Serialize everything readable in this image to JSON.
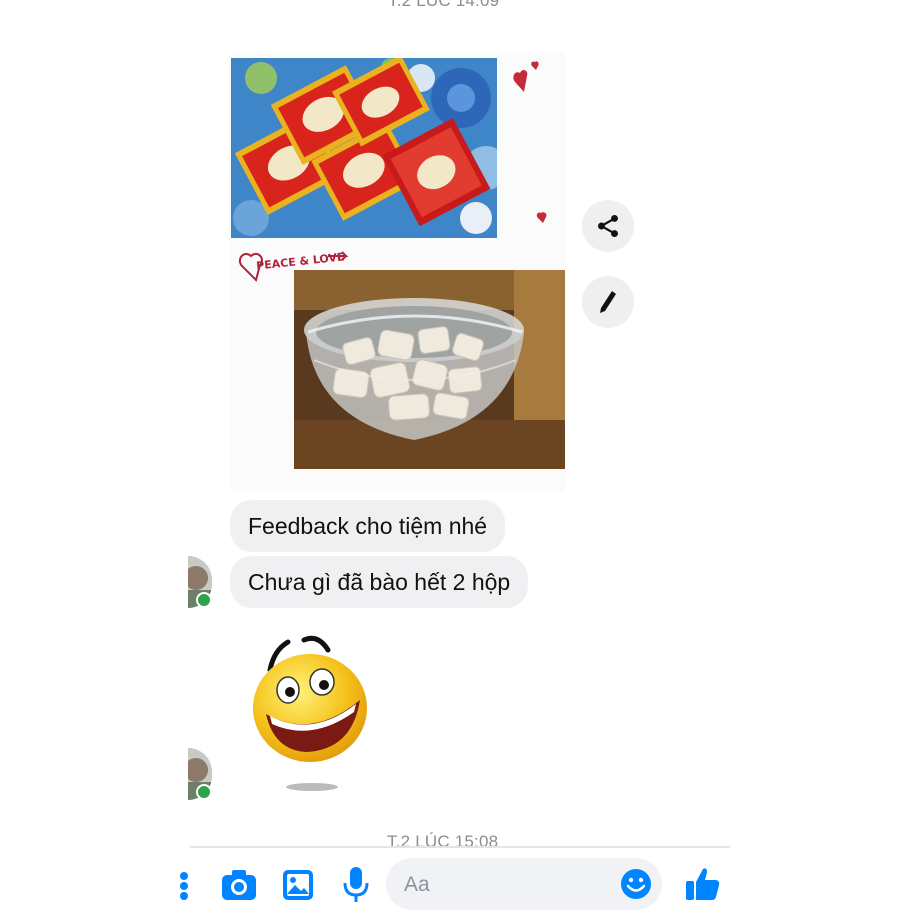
{
  "timestamps": {
    "top": "T.2 LÚC 14:09",
    "bottom": "T.2 LÚC 15:08"
  },
  "photo1": {
    "decoration_text": "PEACE & LOVE"
  },
  "messages": [
    {
      "text": "Feedback cho tiệm nhé"
    },
    {
      "text": "Chưa gì đã bào hết 2 hộp"
    }
  ],
  "composer": {
    "placeholder": "Aa"
  },
  "icons": {
    "share": "share-icon",
    "edit": "pencil-icon",
    "camera": "camera-icon",
    "gallery": "image-icon",
    "mic": "microphone-icon",
    "emoji": "smiley-icon",
    "like": "thumbs-up-icon",
    "sticker": "laughing-emoji-sticker"
  },
  "colors": {
    "accent": "#0084ff",
    "bubble": "#f0f0f2",
    "online": "#31a24c",
    "timestamp": "#8a8d91"
  }
}
